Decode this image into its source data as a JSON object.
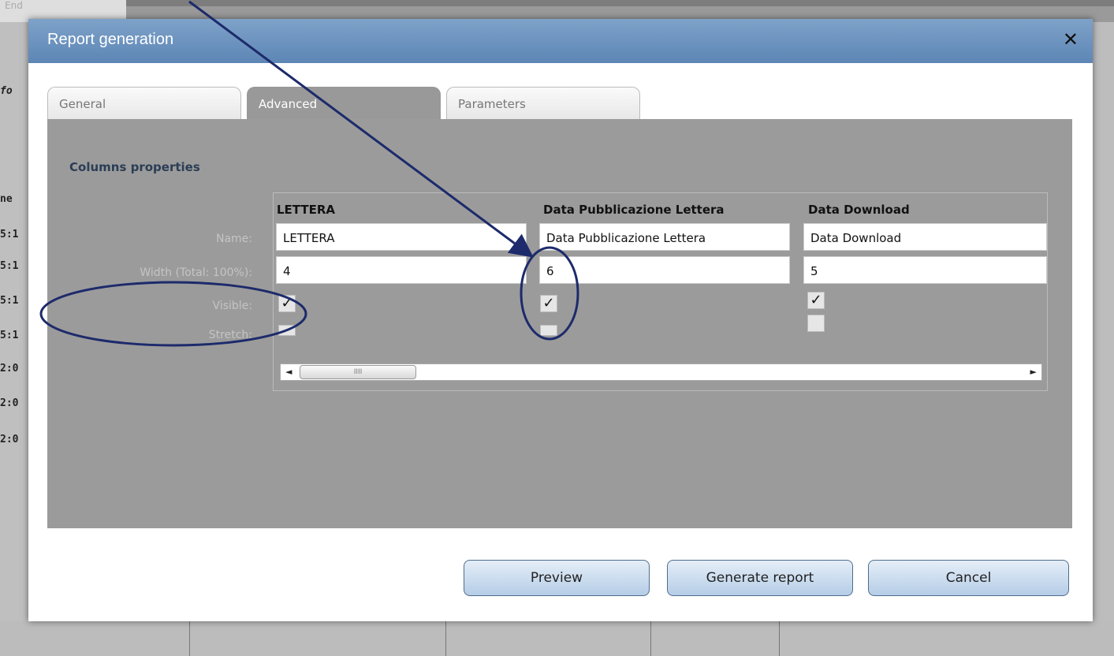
{
  "background": {
    "corner_text": "End",
    "side_fragment_header": "ne",
    "side_fragment_label": "fo",
    "side_rows": [
      "5:1",
      "5:1",
      "5:1",
      "5:1",
      "2:0",
      "2:0",
      "2:0"
    ]
  },
  "dialog": {
    "title": "Report generation",
    "close_glyph": "✕",
    "tabs": [
      {
        "label": "General",
        "active": false
      },
      {
        "label": "Advanced",
        "active": true
      },
      {
        "label": "Parameters",
        "active": false
      }
    ],
    "section_title": "Columns properties",
    "row_labels": {
      "name": "Name:",
      "width": "Width (Total: 100%):",
      "visible": "Visible:",
      "stretch": "Stretch:"
    },
    "columns": [
      {
        "header": "LETTERA",
        "name": "LETTERA",
        "width": "4",
        "visible": true,
        "stretch": false
      },
      {
        "header": "Data Pubblicazione Lettera",
        "name": "Data Pubblicazione Lettera",
        "width": "6",
        "visible": true,
        "stretch": false
      },
      {
        "header": "Data Download",
        "name": "Data Download",
        "width": "5",
        "visible": true,
        "stretch": false
      }
    ],
    "scrollbar": {
      "thumb_grip": "IIII",
      "left_arrow": "◄",
      "right_arrow": "►"
    },
    "buttons": {
      "preview": "Preview",
      "generate": "Generate report",
      "cancel": "Cancel"
    }
  },
  "colors": {
    "title_bar": "#6a90bd",
    "annotation": "#1d2a6b",
    "panel": "#9b9b9b",
    "button_border": "#4f6d8d"
  }
}
